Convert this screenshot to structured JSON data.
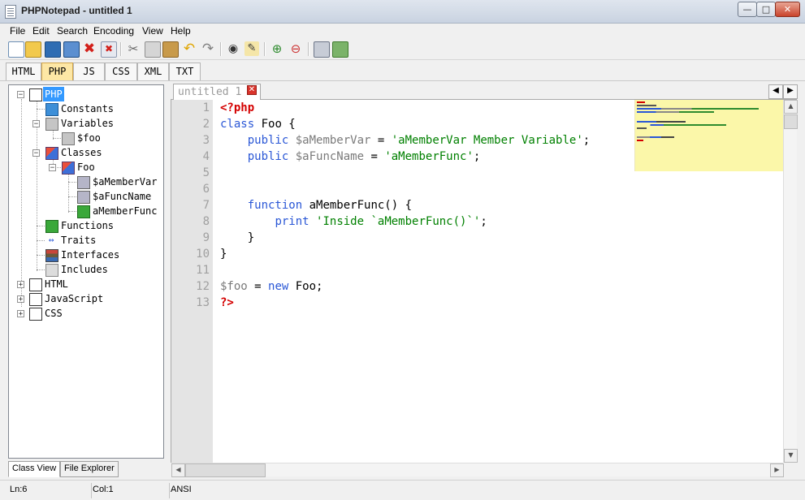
{
  "window": {
    "title": "PHPNotepad - untitled 1"
  },
  "menu": [
    "File",
    "Edit",
    "Search",
    "Encoding",
    "View",
    "Help"
  ],
  "toolbar_icons": [
    "new-file-icon",
    "open-folder-icon",
    "save-icon",
    "save-all-icon",
    "close-icon",
    "close-all-icon",
    "cut-icon",
    "copy-icon",
    "paste-icon",
    "undo-icon",
    "redo-icon",
    "find-icon",
    "replace-icon",
    "zoom-in-icon",
    "zoom-out-icon",
    "print-icon",
    "exit-icon"
  ],
  "language_tabs": [
    {
      "label": "HTML",
      "active": false
    },
    {
      "label": "PHP",
      "active": true
    },
    {
      "label": "JS",
      "active": false
    },
    {
      "label": "CSS",
      "active": false
    },
    {
      "label": "XML",
      "active": false
    },
    {
      "label": "TXT",
      "active": false
    }
  ],
  "tree": {
    "php": "PHP",
    "constants": "Constants",
    "variables": "Variables",
    "foo_var": "$foo",
    "classes": "Classes",
    "foo_class": "Foo",
    "member_var": "$aMemberVar",
    "func_name": "$aFuncName",
    "member_func": "aMemberFunc",
    "functions": "Functions",
    "traits": "Traits",
    "interfaces": "Interfaces",
    "includes": "Includes",
    "html": "HTML",
    "javascript": "JavaScript",
    "css": "CSS"
  },
  "bottom_tabs": [
    "Class View",
    "File Explorer"
  ],
  "editor": {
    "tab_title": "untitled 1",
    "line_numbers": [
      "1",
      "2",
      "3",
      "4",
      "5",
      "6",
      "7",
      "8",
      "9",
      "10",
      "11",
      "12",
      "13"
    ],
    "code": {
      "l1": "<?php",
      "l2_kw": "class",
      "l2_rest": " Foo {",
      "l3_kw": "public",
      "l3_var": "$aMemberVar",
      "l3_eq": " = ",
      "l3_str": "'aMemberVar Member Variable'",
      "l3_end": ";",
      "l4_kw": "public",
      "l4_var": "$aFuncName",
      "l4_eq": " = ",
      "l4_str": "'aMemberFunc'",
      "l4_end": ";",
      "l7_kw": "function",
      "l7_rest": " aMemberFunc() {",
      "l8_kw": "print",
      "l8_str": "'Inside `aMemberFunc()`'",
      "l8_end": ";",
      "l9": "}",
      "l10": "}",
      "l12_var": "$foo",
      "l12_eq": " = ",
      "l12_kw": "new",
      "l12_rest": " Foo;",
      "l13": "?>"
    }
  },
  "status": {
    "line": "Ln:6",
    "col": "Col:1",
    "encoding": "ANSI"
  },
  "colors": {
    "keyword": "#2a57d6",
    "php_tag": "#d40000",
    "variable": "#7a7a7a",
    "string": "#008000",
    "active_tab": "#fde7a5",
    "minimap": "#fbf7a9"
  }
}
